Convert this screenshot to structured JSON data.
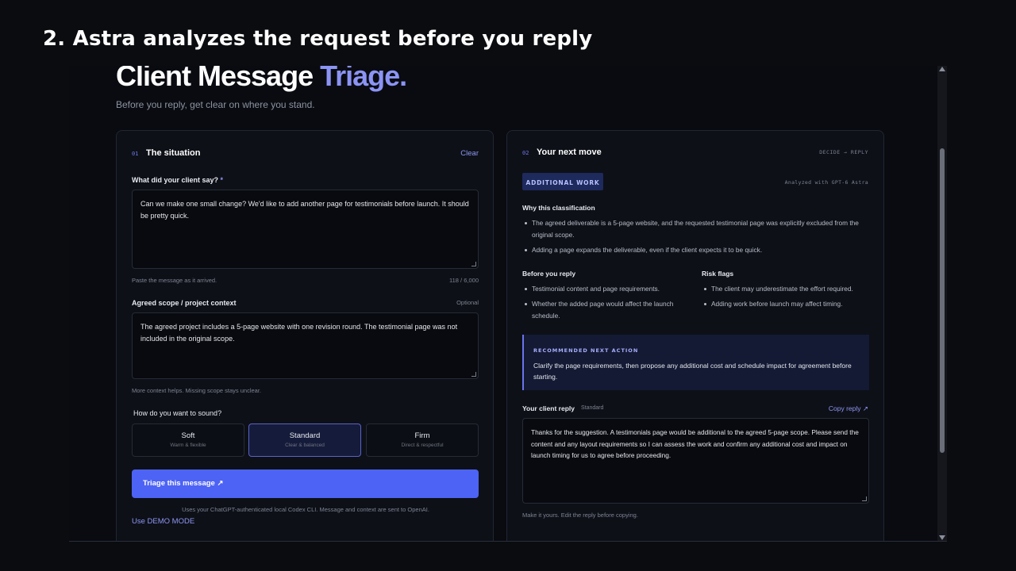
{
  "caption": "2. Astra analyzes the request before you reply",
  "header": {
    "title_main": "Client Message",
    "title_accent": "Triage.",
    "subtitle": "Before you reply, get clear on where you stand."
  },
  "left_panel": {
    "number": "01",
    "title": "The situation",
    "clear_label": "Clear",
    "client_message": {
      "label": "What did your client say?",
      "required_mark": "*",
      "value": "Can we make one small change? We'd like to add another page for testimonials before launch. It should be pretty quick.",
      "hint": "Paste the message as it arrived.",
      "counter": "118 / 6,000"
    },
    "scope": {
      "label": "Agreed scope / project context",
      "optional": "Optional",
      "value": "The agreed project includes a 5-page website with one revision round. The testimonial page was not included in the original scope.",
      "hint": "More context helps. Missing scope stays unclear."
    },
    "tone": {
      "label": "How do you want to sound?",
      "options": [
        {
          "label": "Soft",
          "desc": "Warm & flexible"
        },
        {
          "label": "Standard",
          "desc": "Clear & balanced"
        },
        {
          "label": "Firm",
          "desc": "Direct & respectful"
        }
      ],
      "selected": "Standard"
    },
    "submit_label": "Triage this message ↗",
    "footnote": "Uses your ChatGPT-authenticated local Codex CLI. Message and context are sent to OpenAI.",
    "demo_link": "Use DEMO MODE"
  },
  "right_panel": {
    "number": "02",
    "title": "Your next move",
    "tag": "DECIDE → REPLY",
    "badge": "ADDITIONAL WORK",
    "analyzed_with": "Analyzed with GPT-6 Astra",
    "why_title": "Why this classification",
    "why_items": [
      "The agreed deliverable is a 5-page website, and the requested testimonial page was explicitly excluded from the original scope.",
      "Adding a page expands the deliverable, even if the client expects it to be quick."
    ],
    "before_title": "Before you reply",
    "before_items": [
      "Testimonial content and page requirements.",
      "Whether the added page would affect the launch schedule."
    ],
    "risk_title": "Risk flags",
    "risk_items": [
      "The client may underestimate the effort required.",
      "Adding work before launch may affect timing."
    ],
    "recommended_title": "RECOMMENDED NEXT ACTION",
    "recommended_text": "Clarify the page requirements, then propose any additional cost and schedule impact for agreement before starting.",
    "reply_label": "Your client reply",
    "reply_tone": "Standard",
    "copy_label": "Copy reply ↗",
    "reply_text": "Thanks for the suggestion. A testimonials page would be additional to the agreed 5-page scope. Please send the content and any layout requirements so I can assess the work and confirm any additional cost and impact on launch timing for us to agree before proceeding.",
    "reply_hint": "Make it yours. Edit the reply before copying."
  },
  "colors": {
    "accent": "#4d63f5",
    "accent_text": "#8b93f4",
    "badge_bg": "#1e2a5c",
    "background": "#0a0c10"
  }
}
